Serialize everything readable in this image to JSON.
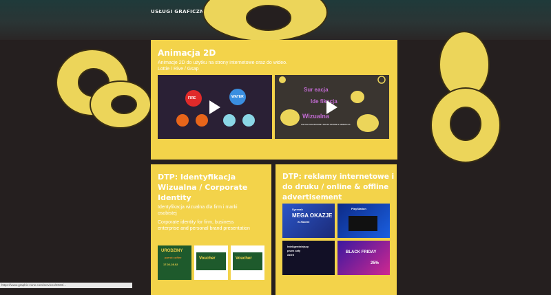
{
  "nav": {
    "title": "USŁUGI GRAFICZNE I MONTAŻ WIDEO & ANIMACJA"
  },
  "card_anim": {
    "title": "Animacja 2D",
    "desc_line1": "Animacje 2D do użytku na strony internetowe oraz do wideo.",
    "desc_line2": "Lottie / Rive / Gsap",
    "video1": {
      "labels": [
        "FIRE",
        "WATER"
      ]
    },
    "video2": {
      "title_line1": "Sur eacja",
      "title_line2": "Ide fikacja",
      "title_line3": "Wizualna",
      "caption": "USŁUGI GRAFICZNE I DRUK STRON & ANIMACJA"
    }
  },
  "card_dtp1": {
    "title_line1": "DTP: Identyfikacja",
    "title_line2": "Wizualna / Corporate",
    "title_line3": "Identity",
    "desc_pl_line1": "Identyfikacja wizualna dla firm i marki",
    "desc_pl_line2": "osobistej",
    "desc_en_line1": "Corporate identity for firm, business",
    "desc_en_line2": "enterprise and personal brand presentation",
    "thumbs": [
      {
        "line1": "URODZINY",
        "line2": "parrot coffee",
        "line3": "17.02-28.02"
      },
      {
        "line1": "Voucher"
      },
      {
        "line1": "Voucher"
      }
    ]
  },
  "card_dtp2": {
    "title_line1": "DTP: reklamy internetowe i",
    "title_line2": "do druku / online & offline",
    "title_line3": "advertisement",
    "thumbs": [
      {
        "line1": "Syrenah",
        "line2": "MEGA OKAZJE",
        "line3": "w Xiaomi"
      },
      {
        "line1": "PlayStation"
      },
      {
        "line1": "Inteligentniejszy",
        "line2": "przez cały",
        "line3": "dzień"
      },
      {
        "line1": "BLACK FRIDAY",
        "line2": "25%"
      }
    ]
  },
  "status_bar": {
    "text": "https://www.graphic-zone.com/services/2023/..."
  },
  "colors": {
    "accent": "#f3d34a",
    "background": "#251f1f"
  }
}
